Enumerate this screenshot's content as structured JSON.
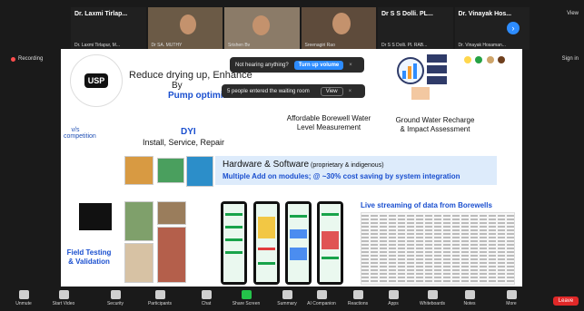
{
  "participants": [
    {
      "name": "Dr. Laxmi Tirlap...",
      "sub": "Dr. Laxmi Tirlapur, M..."
    },
    {
      "name": "",
      "sub": "Dr SA. MUTHY"
    },
    {
      "name": "",
      "sub": "Srishen Bv"
    },
    {
      "name": "",
      "sub": "Sreenagiri Rao"
    },
    {
      "name": "Dr S S Dolli. PL...",
      "sub": "Dr S S Dolli. Pl. RAB..."
    },
    {
      "name": "Dr. Vinayak Hos...",
      "sub": "Dr. Vinayak Hosaman..."
    }
  ],
  "top": {
    "view": "View",
    "signin": "Sign in",
    "recording": "Recording"
  },
  "slide": {
    "logo_text": "USP",
    "title_line1": "Reduce drying up, Enhance",
    "title_line2": "By",
    "title_line3": "Pump optimiz",
    "vs": "v/s competition",
    "dyi": "DYI",
    "dyi_sub": "Install, Service, Repair",
    "affordable": "Affordable Borewell Water Level Measurement",
    "groundwater": "Ground Water Recharge & Impact Assessment",
    "hw_title": "Hardware & Software",
    "hw_small": " (proprietary & indigenous)",
    "hw_sub": "Multiple Add on modules; @ ~30% cost saving by system integration",
    "field": "Field Testing & Validation",
    "live": "Live streaming of data from Borewells"
  },
  "toasts": {
    "hearing": "Not hearing anything?",
    "turnup": "Turn up volume",
    "waiting": "5 people entered the waiting room",
    "view": "View",
    "close": "×"
  },
  "toolbar": [
    {
      "label": "Unmute"
    },
    {
      "label": "Start Video"
    },
    {
      "label": "Security"
    },
    {
      "label": "Participants",
      "count": "14"
    },
    {
      "label": "Chat"
    },
    {
      "label": "Share Screen"
    },
    {
      "label": "Summary"
    },
    {
      "label": "AI Companion"
    },
    {
      "label": "Reactions"
    },
    {
      "label": "Apps"
    },
    {
      "label": "Whiteboards"
    },
    {
      "label": "Notes"
    },
    {
      "label": "More"
    }
  ],
  "leave": "Leave",
  "colors": {
    "accent": "#2d8cff",
    "leave": "#e02828",
    "slide_blue": "#1a4fcf"
  }
}
